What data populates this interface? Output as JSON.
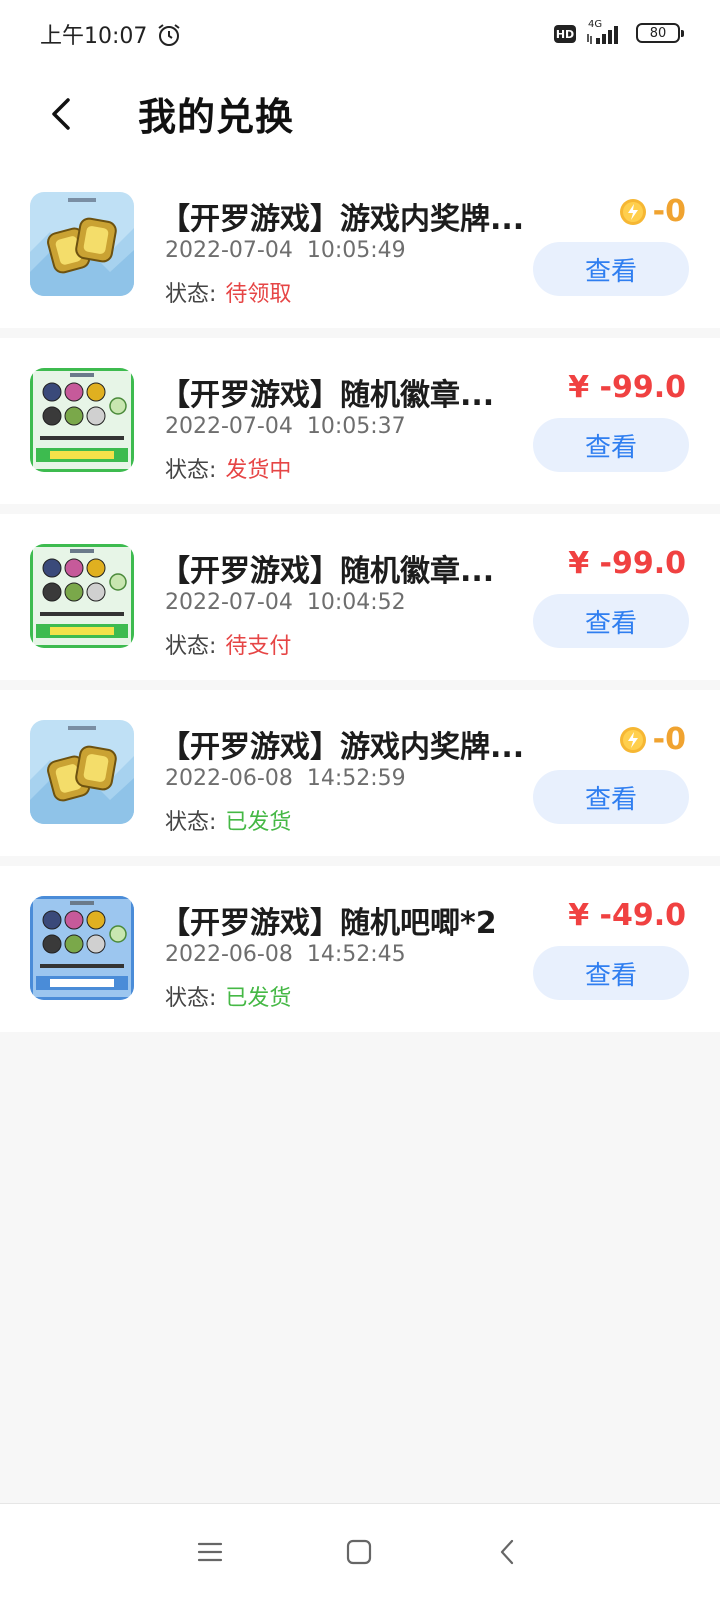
{
  "status_bar": {
    "time": "上午10:07",
    "hd_label": "HD",
    "network": "4G",
    "battery": "80"
  },
  "header": {
    "title": "我的兑换"
  },
  "orders": [
    {
      "title": "【开罗游戏】游戏内奖牌...",
      "date": "2022-07-04  10:05:49",
      "status_label": "状态:",
      "status": "待领取",
      "status_color": "#e64545",
      "price": "-0",
      "price_type": "coin",
      "price_color": "#f0a330",
      "button": "查看",
      "thumb": "medal"
    },
    {
      "title": "【开罗游戏】随机徽章...",
      "date": "2022-07-04  10:05:37",
      "status_label": "状态:",
      "status": "发货中",
      "status_color": "#e64545",
      "price": "¥ -99.0",
      "price_type": "yuan",
      "price_color": "#f04141",
      "button": "查看",
      "thumb": "badge-green"
    },
    {
      "title": "【开罗游戏】随机徽章...",
      "date": "2022-07-04  10:04:52",
      "status_label": "状态:",
      "status": "待支付",
      "status_color": "#e64545",
      "price": "¥ -99.0",
      "price_type": "yuan",
      "price_color": "#f04141",
      "button": "查看",
      "thumb": "badge-green"
    },
    {
      "title": "【开罗游戏】游戏内奖牌...",
      "date": "2022-06-08  14:52:59",
      "status_label": "状态:",
      "status": "已发货",
      "status_color": "#45b845",
      "price": "-0",
      "price_type": "coin",
      "price_color": "#f0a330",
      "button": "查看",
      "thumb": "medal"
    },
    {
      "title": "【开罗游戏】随机吧唧*2",
      "date": "2022-06-08  14:52:45",
      "status_label": "状态:",
      "status": "已发货",
      "status_color": "#45b845",
      "price": "¥ -49.0",
      "price_type": "yuan",
      "price_color": "#f04141",
      "button": "查看",
      "thumb": "badge-blue"
    }
  ],
  "colors": {
    "accent": "#2f7ef0",
    "button_bg": "#e8f0fd",
    "page_bg": "#f7f7f7"
  },
  "nav_bar": {
    "icons": [
      "menu-icon",
      "home-icon",
      "back-icon"
    ]
  }
}
